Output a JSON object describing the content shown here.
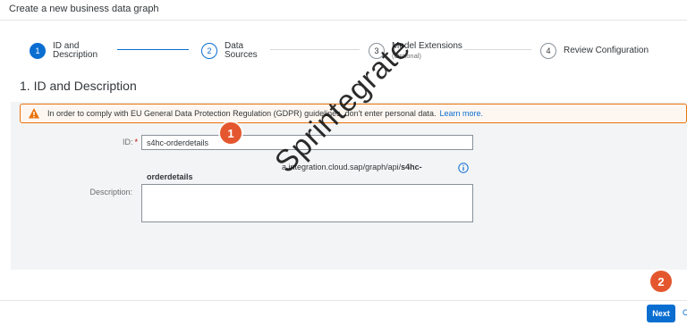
{
  "window": {
    "title": "Create a new business data graph"
  },
  "wizard": {
    "steps": [
      {
        "number": "1",
        "label": "ID and",
        "label2": "Description",
        "sub": ""
      },
      {
        "number": "2",
        "label": "Data",
        "label2": "Sources",
        "sub": ""
      },
      {
        "number": "3",
        "label": "Model Extensions",
        "label2": "",
        "sub": "(Optional)"
      },
      {
        "number": "4",
        "label": "Review Configuration",
        "label2": "",
        "sub": ""
      }
    ]
  },
  "section": {
    "title": "1. ID and Description"
  },
  "warning": {
    "text": "In order to comply with EU General Data Protection Regulation (GDPR) guidelines, don't enter personal data.",
    "link": "Learn more."
  },
  "form": {
    "id_label": "ID:",
    "id_required": "*",
    "id_value": "s4hc-orderdetails",
    "url_hint": "a.integration.cloud.sap/graph/api/",
    "url_hint_bold": "s4hc-",
    "url_hint_bold2": "orderdetails",
    "description_label": "Description:",
    "description_value": ""
  },
  "annotations": {
    "marker1": "1",
    "marker2": "2",
    "watermark": "Sprintegrate"
  },
  "footer": {
    "next_label": "Next",
    "cut_label": "C"
  },
  "colors": {
    "accent": "#0a6ed1",
    "warning": "#e9730c",
    "marker": "#e4572e"
  }
}
